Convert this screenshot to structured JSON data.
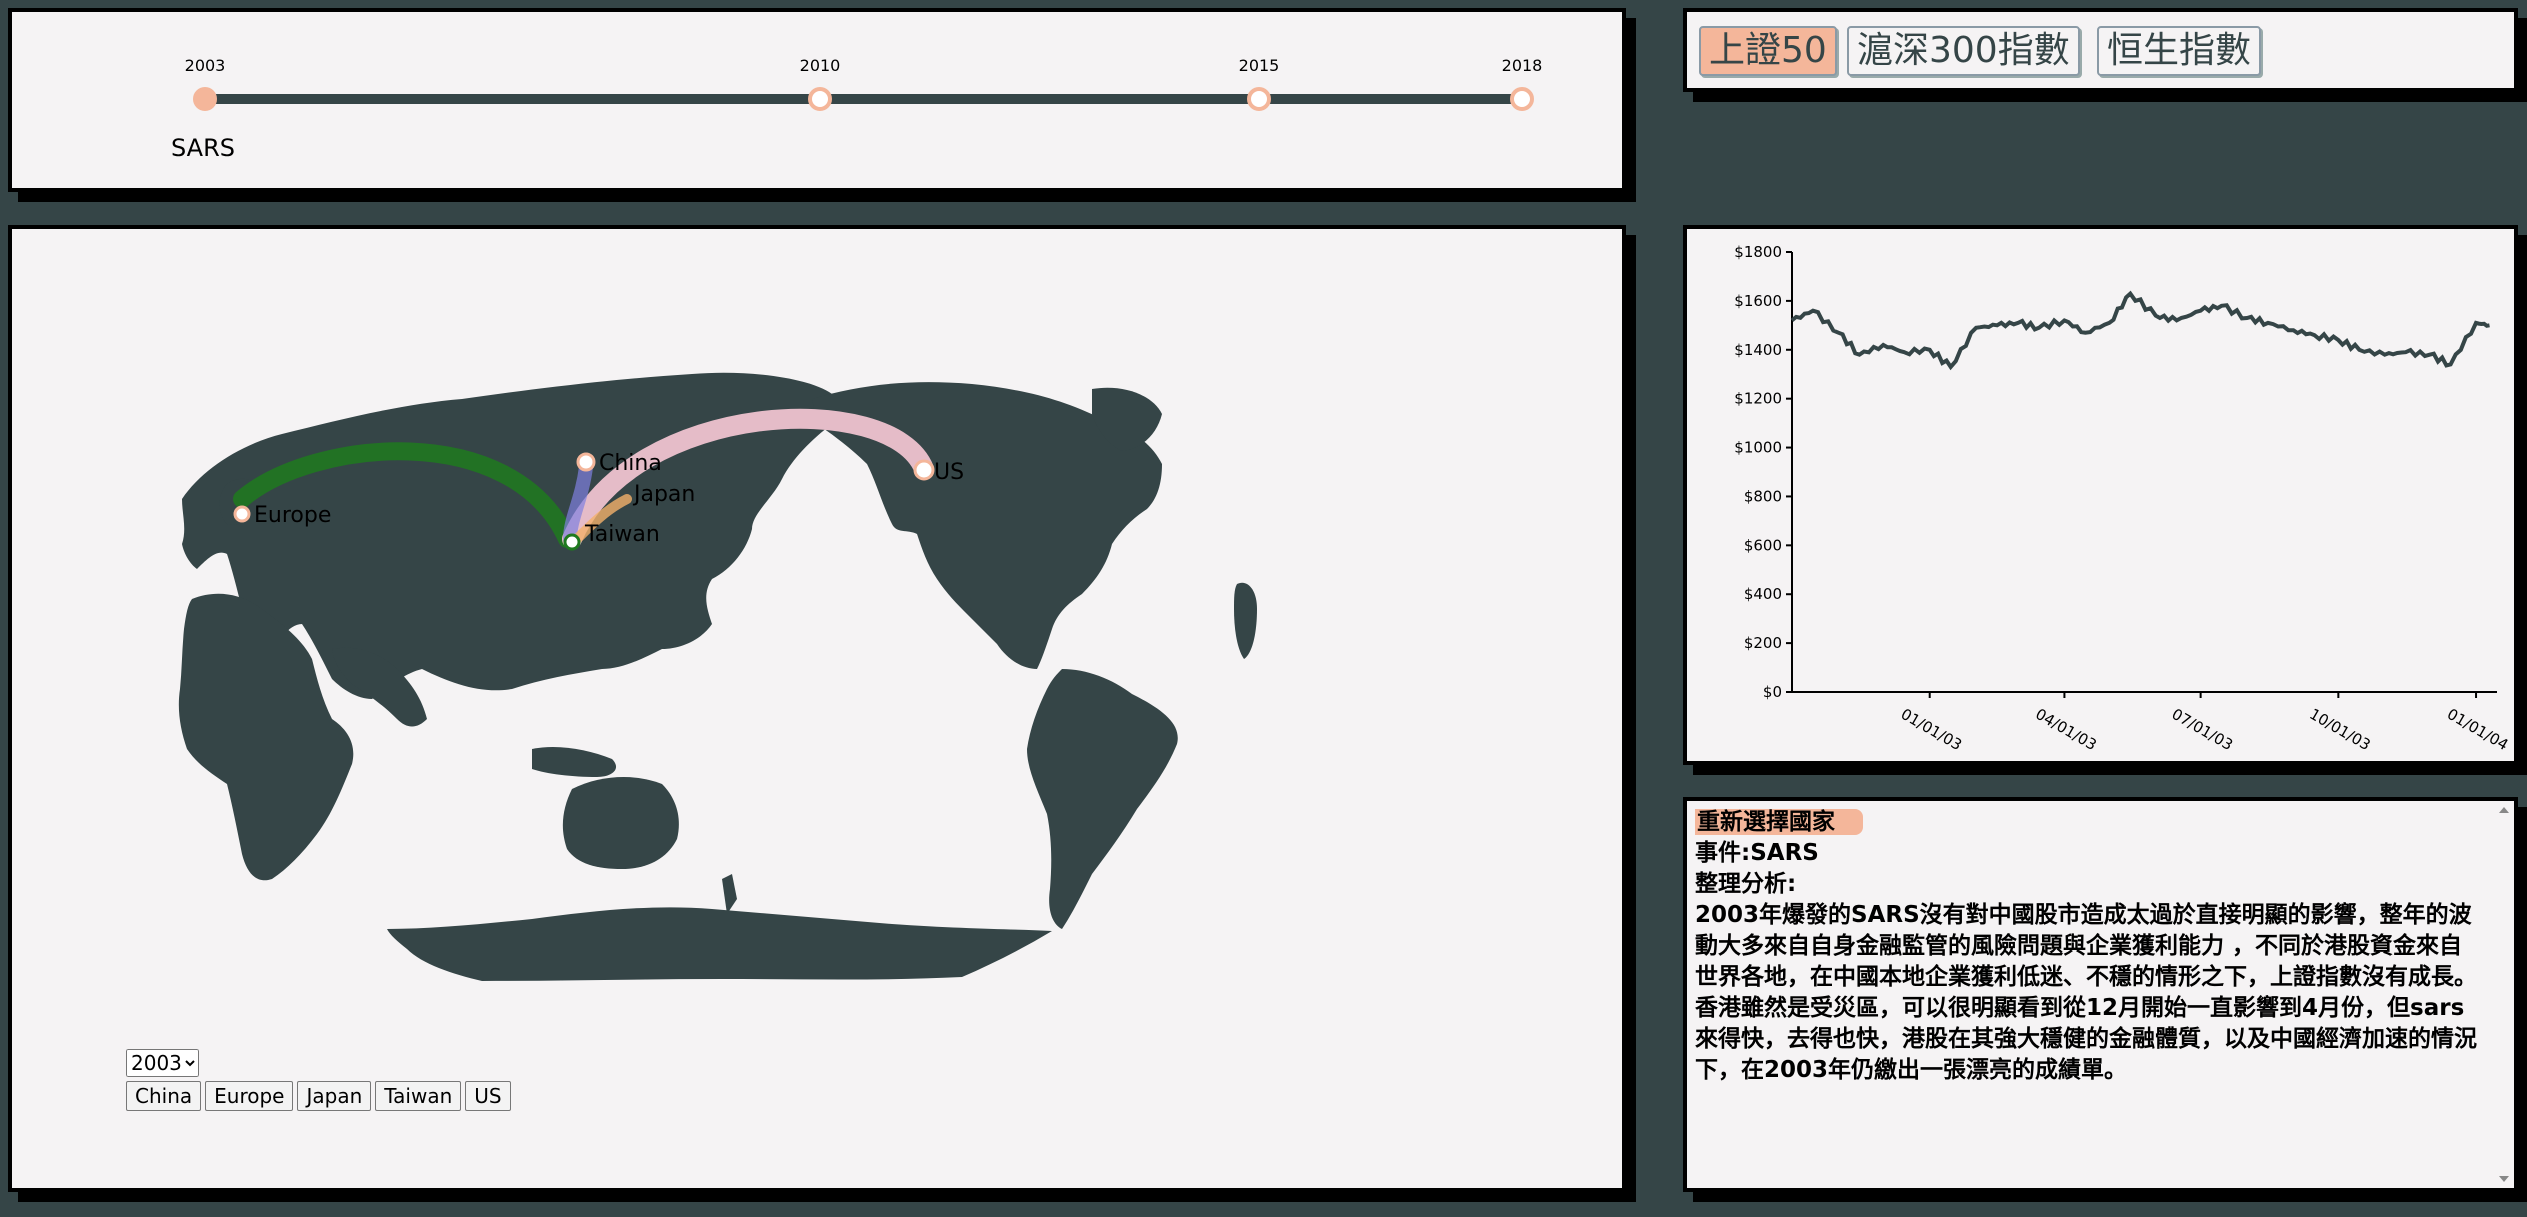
{
  "timeline": {
    "years": [
      "2003",
      "2010",
      "2015",
      "2018"
    ],
    "active_index": 0,
    "event_label": "SARS"
  },
  "indices": {
    "buttons": [
      "上證50",
      "滬深300指數",
      "恒生指數"
    ],
    "active_index": 0
  },
  "map": {
    "countries": [
      {
        "name": "China",
        "color": "#6f6fd6"
      },
      {
        "name": "Japan",
        "color": "#f4b06a"
      },
      {
        "name": "Taiwan",
        "color": "#1f7a1f"
      },
      {
        "name": "Europe",
        "color": "#1f7a1f"
      },
      {
        "name": "US",
        "color": "#f8c9d6"
      }
    ],
    "year_select": {
      "selected": "2003",
      "options": [
        "2003"
      ]
    },
    "country_buttons": [
      "China",
      "Europe",
      "Japan",
      "Taiwan",
      "US"
    ]
  },
  "chart_data": {
    "type": "line",
    "y_ticks": [
      "$0",
      "$200",
      "$400",
      "$600",
      "$800",
      "$1000",
      "$1200",
      "$1400",
      "$1600",
      "$1800"
    ],
    "x_ticks": [
      "01/01/03",
      "04/01/03",
      "07/01/03",
      "10/01/03",
      "01/01/04"
    ],
    "ylim": [
      0,
      1800
    ],
    "xlim": [
      "2002-10-01",
      "2004-01-15"
    ],
    "series": [
      {
        "x": [
          "2002-10-01",
          "2002-10-15",
          "2002-11-01",
          "2002-11-15",
          "2002-12-01",
          "2002-12-15",
          "2003-01-01",
          "2003-01-15",
          "2003-02-01",
          "2003-02-15",
          "2003-03-01",
          "2003-03-15",
          "2003-04-01",
          "2003-04-15",
          "2003-05-01",
          "2003-05-15",
          "2003-06-01",
          "2003-06-15",
          "2003-07-01",
          "2003-07-15",
          "2003-08-01",
          "2003-08-15",
          "2003-09-01",
          "2003-09-15",
          "2003-10-01",
          "2003-10-15",
          "2003-11-01",
          "2003-11-15",
          "2003-12-01",
          "2003-12-15",
          "2004-01-01",
          "2004-01-10"
        ],
        "values": [
          1520,
          1560,
          1470,
          1380,
          1420,
          1390,
          1400,
          1330,
          1490,
          1500,
          1510,
          1490,
          1520,
          1470,
          1510,
          1630,
          1540,
          1520,
          1560,
          1580,
          1530,
          1510,
          1480,
          1460,
          1440,
          1400,
          1380,
          1390,
          1380,
          1340,
          1510,
          1500
        ]
      }
    ]
  },
  "info": {
    "reselect_label": "重新選擇國家",
    "event_line": "事件:SARS",
    "analysis_title": "整理分析:",
    "analysis_body": "2003年爆發的SARS沒有對中國股市造成太過於直接明顯的影響，整年的波動大多來自自身金融監管的風險問題與企業獲利能力 ，不同於港股資金來自世界各地，在中國本地企業獲利低迷、不穩的情形之下，上證指數沒有成長。香港雖然是受災區，可以很明顯看到從12月開始一直影響到4月份，但sars來得快，去得也快，港股在其強大穩健的金融體質，以及中國經濟加速的情況下，在2003年仍繳出一張漂亮的成績單。"
  },
  "colors": {
    "background": "#354547",
    "panel": "#f5f3f4",
    "accent": "#f4b69a",
    "landmass": "#354547"
  }
}
